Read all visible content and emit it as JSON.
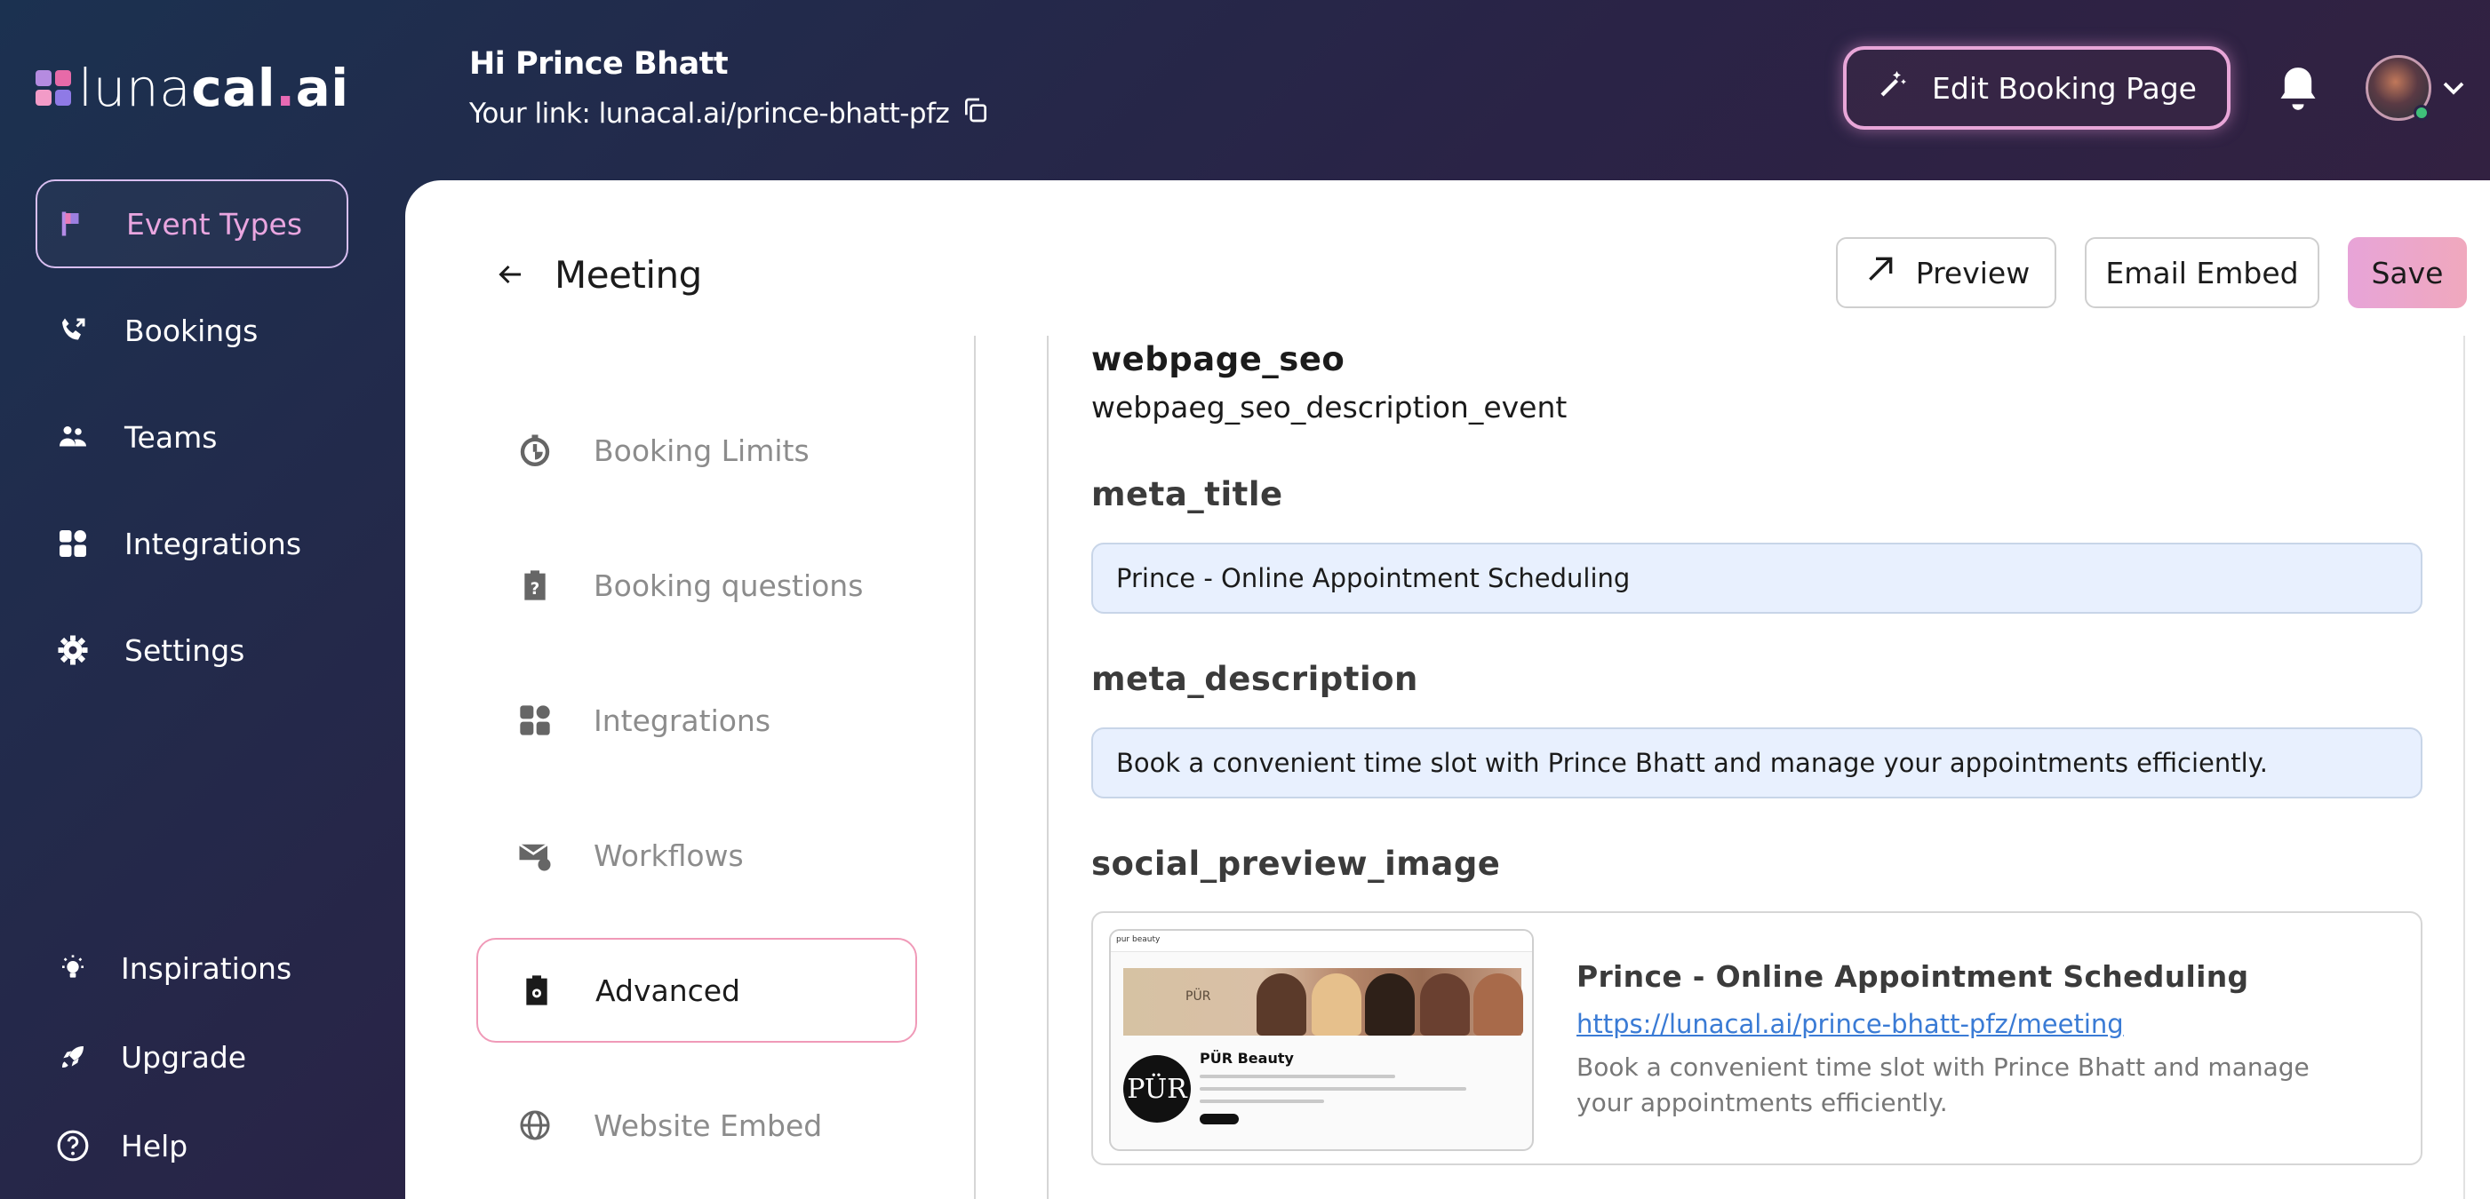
{
  "brand": {
    "name_light": "luna",
    "name_bold": "cal",
    "name_dot": ".",
    "name_end": "ai"
  },
  "sidebar": {
    "items": [
      {
        "label": "Event Types",
        "icon": "flag-icon"
      },
      {
        "label": "Bookings",
        "icon": "phone-icon"
      },
      {
        "label": "Teams",
        "icon": "people-icon"
      },
      {
        "label": "Integrations",
        "icon": "grid-icon"
      },
      {
        "label": "Settings",
        "icon": "gear-icon"
      }
    ],
    "bottom": [
      {
        "label": "Inspirations",
        "icon": "lightbulb-icon"
      },
      {
        "label": "Upgrade",
        "icon": "rocket-icon"
      },
      {
        "label": "Help",
        "icon": "help-icon"
      }
    ]
  },
  "header": {
    "greeting": "Hi Prince Bhatt",
    "link_text": "Your link: lunacal.ai/prince-bhatt-pfz",
    "edit_booking_label": "Edit Booking Page"
  },
  "main": {
    "title": "Meeting",
    "preview_label": "Preview",
    "email_embed_label": "Email Embed",
    "save_label": "Save",
    "menu": [
      {
        "label": "Booking Limits",
        "icon": "timer-icon"
      },
      {
        "label": "Booking questions",
        "icon": "clipboard-question-icon"
      },
      {
        "label": "Integrations",
        "icon": "grid-icon"
      },
      {
        "label": "Workflows",
        "icon": "mail-icon"
      },
      {
        "label": "Advanced",
        "icon": "clipboard-settings-icon",
        "active": true
      },
      {
        "label": "Website Embed",
        "icon": "globe-icon"
      }
    ],
    "seo": {
      "heading": "webpage_seo",
      "description": "webpaeg_seo_description_event",
      "meta_title_label": "meta_title",
      "meta_title_value": "Prince  - Online Appointment Scheduling",
      "meta_description_label": "meta_description",
      "meta_description_value": "Book a convenient time slot with Prince Bhatt and manage your appointments efficiently.",
      "social_label": "social_preview_image"
    },
    "social_card": {
      "thumb_brand": "PÜR Beauty",
      "thumb_logo": "PÜR",
      "thumb_search": "pur beauty",
      "thumb_banner_text": "PÜR",
      "title": "Prince - Online Appointment Scheduling",
      "url": "https://lunacal.ai/prince-bhatt-pfz/meeting",
      "description": "Book a convenient time slot with Prince Bhatt and manage your appointments efficiently."
    }
  },
  "colors": {
    "accent_pink": "#e9a6e0",
    "link_blue": "#3a7bd5",
    "save_gradient_start": "#e7a4d8",
    "field_bg": "#e8f0fe"
  }
}
